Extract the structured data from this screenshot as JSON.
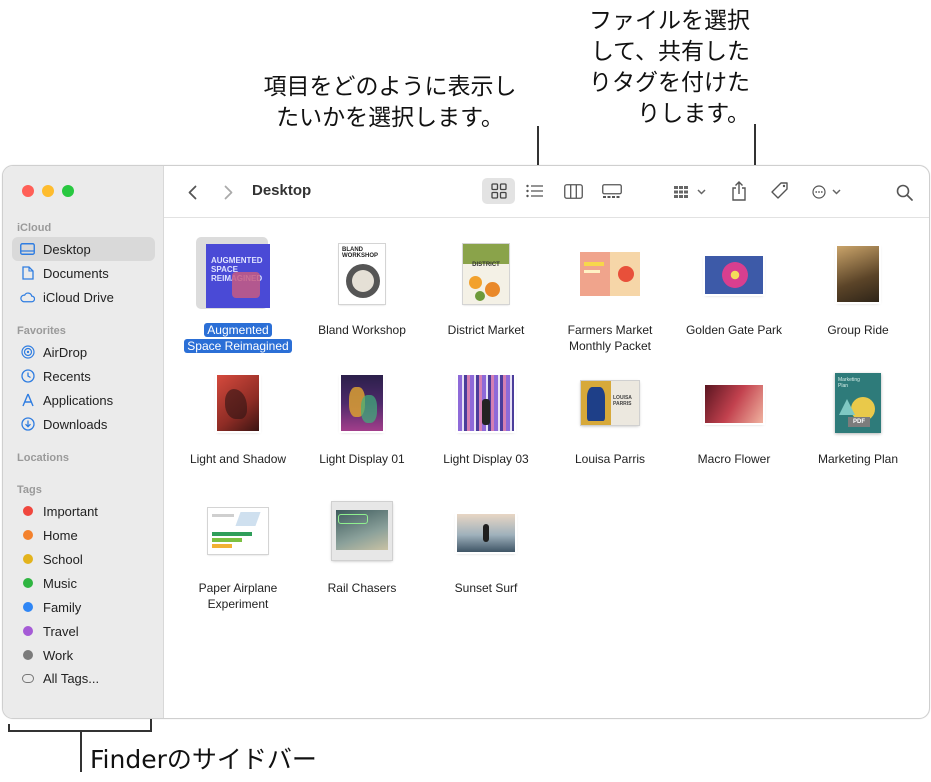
{
  "callouts": {
    "view": "項目をどのように表示し\nたいかを選択します。",
    "share": "ファイルを選択\nして、共有した\nりタグを付けた\nりします。",
    "sidebar": "Finderのサイドバー"
  },
  "window": {
    "title": "Desktop"
  },
  "sidebar": {
    "section_icloud": "iCloud",
    "icloud_items": [
      {
        "label": "Desktop",
        "icon": "desktop-icon"
      },
      {
        "label": "Documents",
        "icon": "document-icon"
      },
      {
        "label": "iCloud Drive",
        "icon": "cloud-icon"
      }
    ],
    "section_favorites": "Favorites",
    "favorites": [
      {
        "label": "AirDrop",
        "icon": "airdrop-icon"
      },
      {
        "label": "Recents",
        "icon": "clock-icon"
      },
      {
        "label": "Applications",
        "icon": "applications-icon"
      },
      {
        "label": "Downloads",
        "icon": "download-icon"
      }
    ],
    "section_locations": "Locations",
    "section_tags": "Tags",
    "tags": [
      {
        "label": "Important",
        "color": "#f0473e"
      },
      {
        "label": "Home",
        "color": "#f3812c"
      },
      {
        "label": "School",
        "color": "#e3b31c"
      },
      {
        "label": "Music",
        "color": "#2fb541"
      },
      {
        "label": "Family",
        "color": "#2f86f5"
      },
      {
        "label": "Travel",
        "color": "#a55bd6"
      },
      {
        "label": "Work",
        "color": "#7b7b7b"
      }
    ],
    "all_tags": "All Tags..."
  },
  "files": [
    {
      "name": "Augmented Space Reimagined",
      "line1": "Augmented",
      "line2": "Space Reimagined",
      "selected": true
    },
    {
      "name": "Bland Workshop"
    },
    {
      "name": "District Market"
    },
    {
      "name": "Farmers Market Monthly Packet",
      "line1": "Farmers Market",
      "line2": "Monthly Packet"
    },
    {
      "name": "Golden Gate Park"
    },
    {
      "name": "Group Ride"
    },
    {
      "name": "Light and Shadow"
    },
    {
      "name": "Light Display 01"
    },
    {
      "name": "Light Display 03"
    },
    {
      "name": "Louisa Parris"
    },
    {
      "name": "Macro Flower"
    },
    {
      "name": "Marketing Plan"
    },
    {
      "name": "Paper Airplane Experiment",
      "line1": "Paper Airplane",
      "line2": "Experiment"
    },
    {
      "name": "Rail Chasers"
    },
    {
      "name": "Sunset Surf"
    }
  ],
  "thumb_text": {
    "augmented": "AUGMENTED SPACE REIMAGINED",
    "bland": "BLAND WORKSHOP",
    "district": "DISTRICT",
    "louisa": "LOUISA PARRIS",
    "marketing": "Marketing Plan",
    "pdf": "PDF"
  },
  "accent": "#2b6fd6"
}
